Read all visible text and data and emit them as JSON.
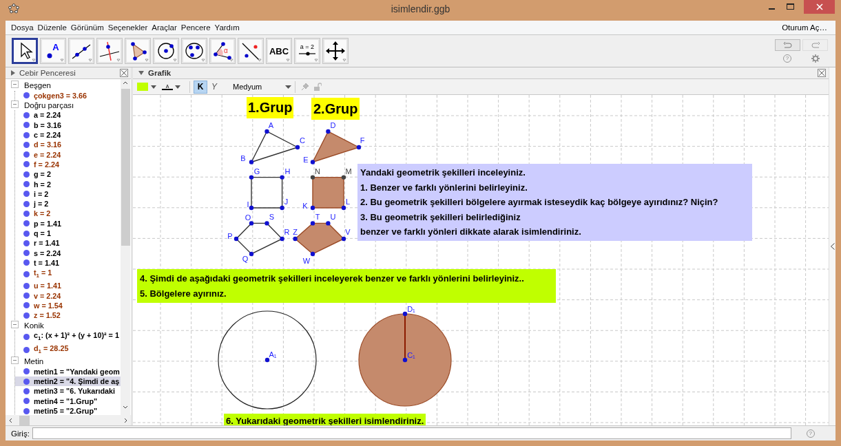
{
  "window": {
    "title": "isimlendir.ggb"
  },
  "menu": [
    "Dosya",
    "Düzenle",
    "Görünüm",
    "Seçenekler",
    "Araçlar",
    "Pencere",
    "Yardım"
  ],
  "sign_in": "Oturum Aç…",
  "toolbar": {
    "tools": [
      {
        "kind": "move",
        "selected": true
      },
      {
        "kind": "point",
        "glyph": "A",
        "selected": false
      },
      {
        "kind": "line",
        "selected": false
      },
      {
        "kind": "perpendicular",
        "selected": false
      },
      {
        "kind": "polygon",
        "selected": false
      },
      {
        "kind": "circle",
        "selected": false
      },
      {
        "kind": "conic",
        "selected": false
      },
      {
        "kind": "angle",
        "glyph": "α",
        "selected": false
      },
      {
        "kind": "reflect",
        "selected": false
      },
      {
        "kind": "text",
        "glyph": "ABC",
        "selected": false
      },
      {
        "kind": "slider",
        "glyph": "a = 2",
        "selected": false
      },
      {
        "kind": "pan",
        "selected": false
      }
    ],
    "help": "?"
  },
  "algebra": {
    "title": "Cebir Penceresi",
    "groups": [
      {
        "label": "Beşgen",
        "expanded": true,
        "children": [
          {
            "text": "çokgen3 = 3.66",
            "color": "#993300",
            "selected": false
          }
        ]
      },
      {
        "label": "Doğru parçası",
        "expanded": true,
        "children": [
          {
            "text": "a = 2.24",
            "color": "#000000",
            "selected": false
          },
          {
            "text": "b = 3.16",
            "color": "#000000",
            "selected": false
          },
          {
            "text": "c = 2.24",
            "color": "#000000",
            "selected": false
          },
          {
            "text": "d = 3.16",
            "color": "#993300",
            "selected": false
          },
          {
            "text": "e = 2.24",
            "color": "#993300",
            "selected": false
          },
          {
            "text": "f = 2.24",
            "color": "#993300",
            "selected": false
          },
          {
            "text": "g = 2",
            "color": "#000000",
            "selected": false
          },
          {
            "text": "h = 2",
            "color": "#000000",
            "selected": false
          },
          {
            "text": "i = 2",
            "color": "#000000",
            "selected": false
          },
          {
            "text": "j = 2",
            "color": "#000000",
            "selected": false
          },
          {
            "text": "k = 2",
            "color": "#993300",
            "selected": false
          },
          {
            "text": "p = 1.41",
            "color": "#000000",
            "selected": false
          },
          {
            "text": "q = 1",
            "color": "#000000",
            "selected": false
          },
          {
            "text": "r = 1.41",
            "color": "#000000",
            "selected": false
          },
          {
            "text": "s = 2.24",
            "color": "#000000",
            "selected": false
          },
          {
            "text": "t = 1.41",
            "color": "#000000",
            "selected": false
          },
          {
            "text": "t$_{1}$ = 1",
            "color": "#993300",
            "selected": false
          },
          {
            "text": "u = 1.41",
            "color": "#993300",
            "selected": false
          },
          {
            "text": "v = 2.24",
            "color": "#993300",
            "selected": false
          },
          {
            "text": "w = 1.54",
            "color": "#993300",
            "selected": false
          },
          {
            "text": "z = 1.52",
            "color": "#993300",
            "selected": false
          }
        ]
      },
      {
        "label": "Konik",
        "expanded": true,
        "children": [
          {
            "text": "c$_{1}$: (x + 1)² + (y + 10)² = 1",
            "color": "#000000",
            "selected": false
          },
          {
            "text": "d$_{1}$ = 28.25",
            "color": "#993300",
            "selected": false
          }
        ]
      },
      {
        "label": "Metin",
        "expanded": true,
        "children": [
          {
            "text": "metin1 = \"Yandaki geom",
            "color": "#000000",
            "selected": false
          },
          {
            "text": "metin2 = \"4. Şimdi de aş",
            "color": "#000000",
            "selected": true
          },
          {
            "text": "metin3 = \"6. Yukarıdaki",
            "color": "#000000",
            "selected": false
          },
          {
            "text": "metin4 = \"1.Grup\"",
            "color": "#000000",
            "selected": false
          },
          {
            "text": "metin5 = \"2.Grup\"",
            "color": "#000000",
            "selected": false
          }
        ]
      }
    ]
  },
  "graphics": {
    "title": "Grafik",
    "style_bar": {
      "color": "#c0ff00",
      "text_color_glyph": "A",
      "bold": {
        "label": "K",
        "selected": true
      },
      "italic": {
        "label": "Y",
        "selected": false
      },
      "size": "Medyum"
    },
    "figures": [
      {
        "kind": "polygon",
        "filled": false,
        "points": [
          {
            "label": "A",
            "color": "#1010d0"
          },
          {
            "label": "B",
            "color": "#1010d0"
          },
          {
            "label": "C",
            "color": "#1010d0"
          }
        ]
      },
      {
        "kind": "polygon",
        "filled": true,
        "points": [
          {
            "label": "D",
            "color": "#1010d0"
          },
          {
            "label": "E",
            "color": "#1010d0"
          },
          {
            "label": "F",
            "color": "#1010d0"
          }
        ]
      },
      {
        "kind": "polygon",
        "filled": false,
        "points": [
          {
            "label": "G",
            "color": "#1010d0"
          },
          {
            "label": "H",
            "color": "#1010d0"
          },
          {
            "label": "I",
            "color": "#1010d0"
          },
          {
            "label": "J",
            "color": "#1010d0"
          }
        ]
      },
      {
        "kind": "polygon",
        "filled": true,
        "points": [
          {
            "label": "N",
            "color": "#444444"
          },
          {
            "label": "M",
            "color": "#444444"
          },
          {
            "label": "K",
            "color": "#1010d0"
          },
          {
            "label": "L",
            "color": "#1010d0"
          }
        ]
      },
      {
        "kind": "polygon",
        "filled": false,
        "points": [
          {
            "label": "O",
            "color": "#1010d0"
          },
          {
            "label": "S",
            "color": "#1010d0"
          },
          {
            "label": "R",
            "color": "#1010d0"
          },
          {
            "label": "Q",
            "color": "#1010d0"
          },
          {
            "label": "P",
            "color": "#1010d0"
          }
        ]
      },
      {
        "kind": "polygon",
        "filled": true,
        "points": [
          {
            "label": "T",
            "color": "#1010d0"
          },
          {
            "label": "U",
            "color": "#1010d0"
          },
          {
            "label": "V",
            "color": "#1010d0"
          },
          {
            "label": "W",
            "color": "#1010d0"
          },
          {
            "label": "Z",
            "color": "#1010d0"
          }
        ]
      },
      {
        "kind": "circle",
        "filled": false,
        "points": [
          {
            "label": "A₁",
            "color": "#1010d0"
          }
        ]
      },
      {
        "kind": "circle",
        "filled": true,
        "points": [
          {
            "label": "D₁",
            "color": "#1010d0"
          },
          {
            "label": "C₁",
            "color": "#1010d0"
          }
        ]
      }
    ],
    "texts": [
      {
        "lines": [
          "1.Grup"
        ],
        "color": "#ffff00"
      },
      {
        "lines": [
          "2.Grup"
        ],
        "color": "#ffff00"
      },
      {
        "lines": [
          "Yandaki geometrik şekilleri inceleyiniz.",
          "1. Benzer ve farklı yönlerini belirleyiniz.",
          "2. Bu geometrik şekilleri bölgelere ayırmak isteseydik kaç bölgeye ayırıdınız? Niçin?",
          "3. Bu geometrik şekilleri belirlediğiniz",
          "benzer ve farklı yönleri dikkate alarak isimlendiriniz."
        ],
        "color": "#ccccff"
      },
      {
        "lines": [
          "4. Şimdi de aşağıdaki geometrik şekilleri inceleyerek benzer ve farklı yönlerini belirleyiniz..",
          "5. Bölgelere ayırınız."
        ],
        "color": "#c0ff00"
      },
      {
        "lines": [
          "6. Yukarıdaki geometrik şekilleri isimlendiriniz."
        ],
        "color": "#c0ff00"
      }
    ]
  },
  "input_bar": {
    "label": "Giriş:",
    "help": "?"
  }
}
